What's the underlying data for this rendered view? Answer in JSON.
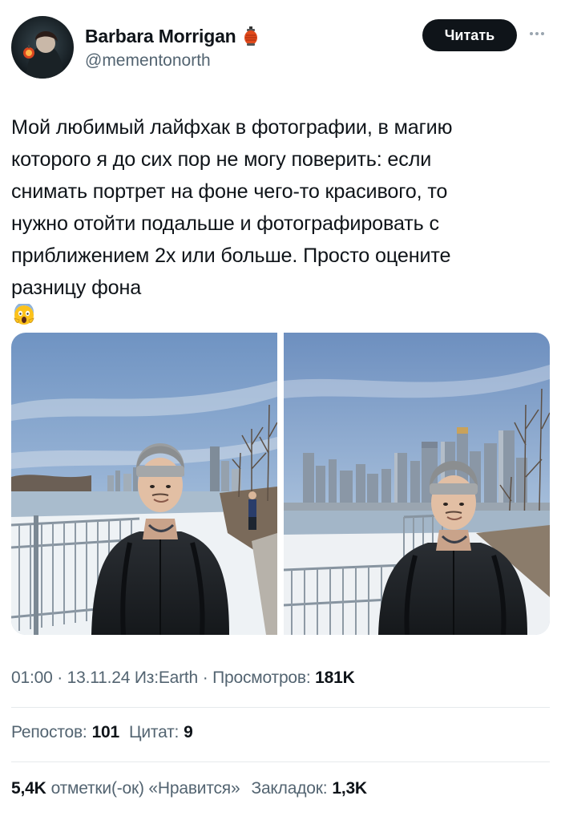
{
  "author": {
    "name": "Barbara Morrigan",
    "handle": "@mementonorth",
    "badge_icon": "lantern-icon"
  },
  "actions": {
    "follow_label": "Читать",
    "more_icon": "more-icon"
  },
  "tweet": {
    "lines": [
      "Мой любимый лайфхак в фотографии, в магию",
      "которого я до сих пор не могу поверить: если",
      "снимать портрет на фоне чего-то красивого, то",
      "нужно отойти подальше и фотографировать с",
      "приближением 2х или больше. Просто оцените",
      "разницу фона"
    ],
    "emoji": "face-screaming-in-fear"
  },
  "meta": {
    "time": "01:00",
    "date": "13.11.24",
    "source_label": "Из:",
    "source": "Earth",
    "views_label": "Просмотров:",
    "views_value": "181K"
  },
  "stats": {
    "reposts_label": "Репостов:",
    "reposts_value": "101",
    "quotes_label": "Цитат:",
    "quotes_value": "9",
    "likes_value": "5,4K",
    "likes_label": "отметки(-ок) «Нравится»",
    "bookmarks_label": "Закладок:",
    "bookmarks_value": "1,3K"
  },
  "colors": {
    "primary_text": "#0f1419",
    "secondary_text": "#536471",
    "follow_bg": "#0f1419",
    "divider": "#e6e9ec"
  }
}
